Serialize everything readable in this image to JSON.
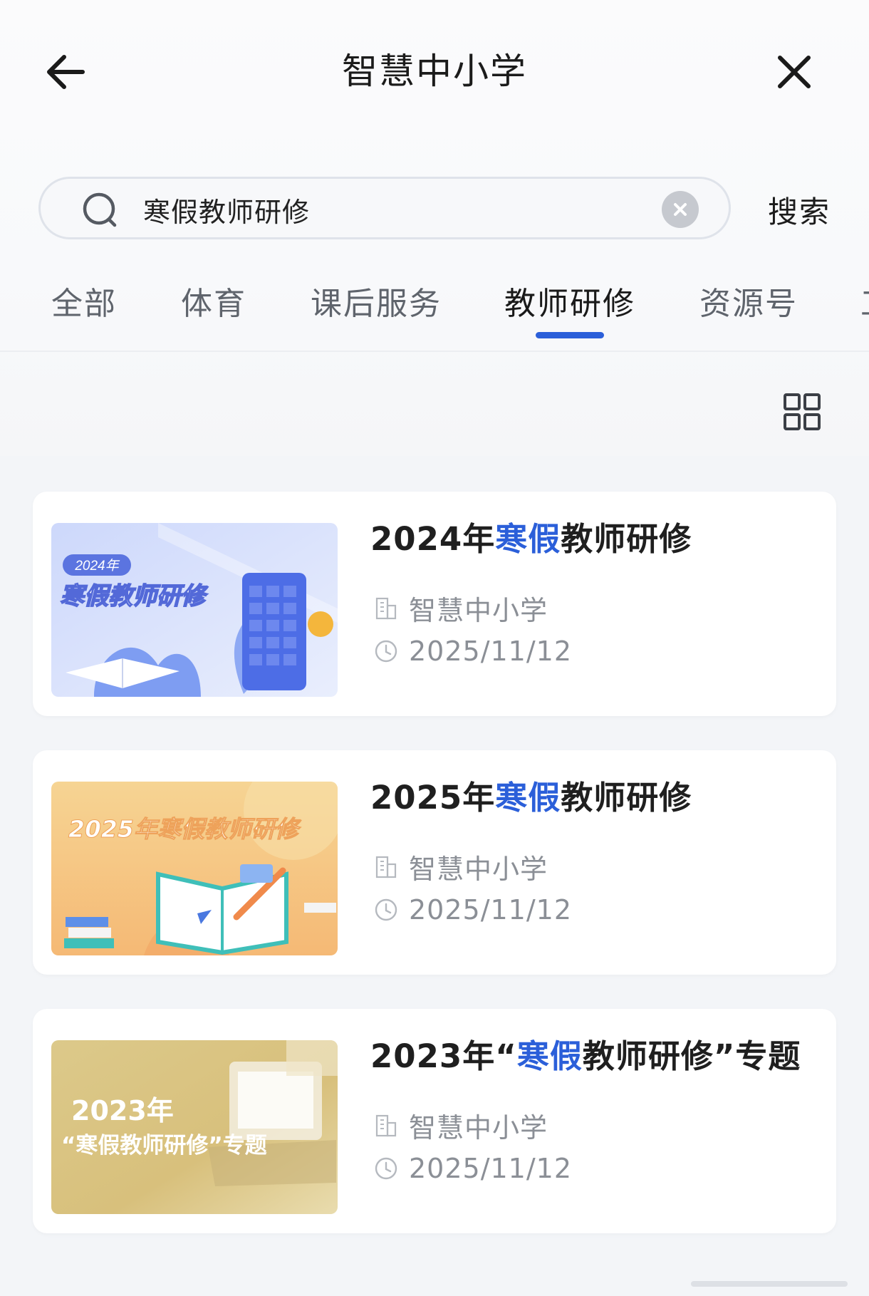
{
  "header": {
    "title": "智慧中小学",
    "back_icon": "back-arrow-icon",
    "close_icon": "close-icon"
  },
  "search": {
    "value": "寒假教师研修",
    "button_label": "搜索"
  },
  "tabs": [
    {
      "label": "全部",
      "active": false
    },
    {
      "label": "体育",
      "active": false
    },
    {
      "label": "课后服务",
      "active": false
    },
    {
      "label": "教师研修",
      "active": true
    },
    {
      "label": "资源号",
      "active": false
    },
    {
      "label": "工",
      "active": false
    }
  ],
  "colors": {
    "accent": "#2b5fd9",
    "page_bg": "#f3f5f8",
    "card_bg": "#ffffff"
  },
  "results": [
    {
      "title_pre": "2024年",
      "title_hl": "寒假",
      "title_post": "教师研修",
      "source": "智慧中小学",
      "date": "2025/11/12",
      "thumb_year": "2024年",
      "thumb_title": "寒假教师研修"
    },
    {
      "title_pre": "2025年",
      "title_hl": "寒假",
      "title_post": "教师研修",
      "source": "智慧中小学",
      "date": "2025/11/12",
      "thumb_title": "2025年寒假教师研修"
    },
    {
      "title_pre": "2023年“",
      "title_hl": "寒假",
      "title_post": "教师研修”专题",
      "source": "智慧中小学",
      "date": "2025/11/12",
      "thumb_year": "2023年",
      "thumb_title": "“寒假教师研修”专题"
    }
  ]
}
